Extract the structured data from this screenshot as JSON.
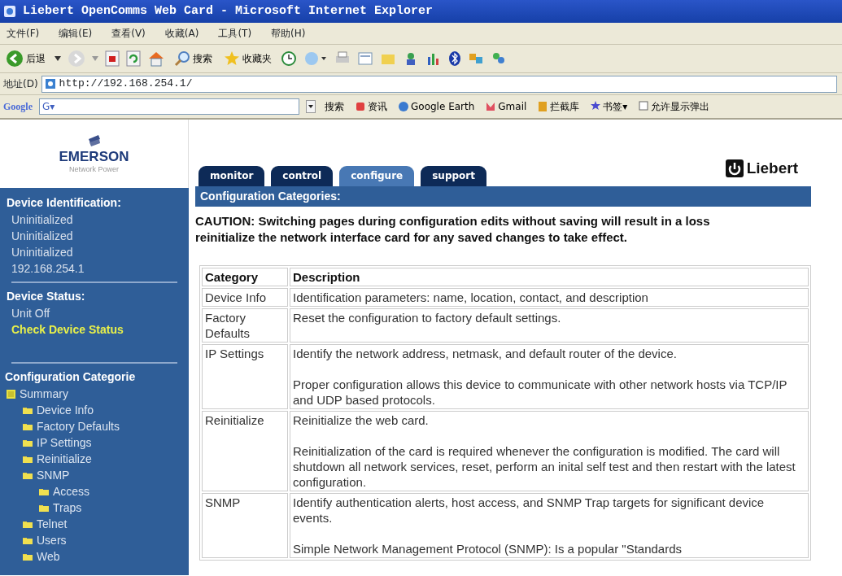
{
  "window": {
    "title": "Liebert OpenComms Web Card - Microsoft Internet Explorer"
  },
  "menu": [
    "文件(F)",
    "编辑(E)",
    "查看(V)",
    "收藏(A)",
    "工具(T)",
    "帮助(H)"
  ],
  "toolbar": {
    "back_label": "后退",
    "search_label": "搜索",
    "favorites_label": "收藏夹"
  },
  "address": {
    "label": "地址(D)",
    "value": "http://192.168.254.1/"
  },
  "google_toolbar": {
    "logo": "Google",
    "field": "G▾",
    "items": [
      "搜索",
      "资讯",
      "Google Earth",
      "Gmail",
      "拦截库",
      "书签▾",
      "允许显示弹出"
    ]
  },
  "brand": {
    "name": "EMERSON",
    "tagline": "Network Power",
    "partner": "Liebert"
  },
  "tabs": [
    {
      "label": "monitor",
      "selected": false
    },
    {
      "label": "control",
      "selected": false
    },
    {
      "label": "configure",
      "selected": true
    },
    {
      "label": "support",
      "selected": false
    }
  ],
  "sidebar": {
    "identification": {
      "heading": "Device Identification:",
      "lines": [
        "Uninitialized",
        "Uninitialized",
        "Uninitialized",
        "192.168.254.1"
      ]
    },
    "status": {
      "heading": "Device Status:",
      "lines": [
        {
          "text": "Unit Off",
          "kind": "normal"
        },
        {
          "text": "Check Device Status",
          "kind": "alert"
        }
      ]
    },
    "categories": {
      "heading": "Configuration Categorie",
      "tree": [
        {
          "label": "Summary",
          "children": [
            {
              "label": "Device Info"
            },
            {
              "label": "Factory Defaults"
            },
            {
              "label": "IP Settings"
            },
            {
              "label": "Reinitialize"
            },
            {
              "label": "SNMP",
              "children": [
                {
                  "label": "Access"
                },
                {
                  "label": "Traps"
                }
              ]
            },
            {
              "label": "Telnet"
            },
            {
              "label": "Users"
            },
            {
              "label": "Web"
            }
          ]
        }
      ]
    }
  },
  "header": "Configuration Categories:",
  "caution": [
    "CAUTION: Switching pages during configuration edits without saving will result in a loss",
    "reinitialize the network interface card for any saved changes to take effect."
  ],
  "table": {
    "columns": [
      "Category",
      "Description"
    ],
    "rows": [
      {
        "category": "Device Info",
        "description": [
          "Identification parameters: name, location, contact, and description"
        ]
      },
      {
        "category": "Factory Defaults",
        "description": [
          "Reset the configuration to factory default settings."
        ]
      },
      {
        "category": "IP Settings",
        "description": [
          "Identify the network address, netmask, and default router of the device.",
          "Proper configuration allows this device to communicate with other network hosts via TCP/IP and UDP based protocols."
        ]
      },
      {
        "category": "Reinitialize",
        "description": [
          "Reinitialize the web card.",
          "Reinitialization of the card is required whenever the configuration is modified. The card will shutdown all network services, reset, perform an inital self test and then restart with the latest configuration."
        ]
      },
      {
        "category": "SNMP",
        "description": [
          "Identify authentication alerts, host access, and SNMP Trap targets for significant device events.",
          "Simple Network Management Protocol (SNMP): Is a popular \"Standards"
        ]
      }
    ]
  }
}
